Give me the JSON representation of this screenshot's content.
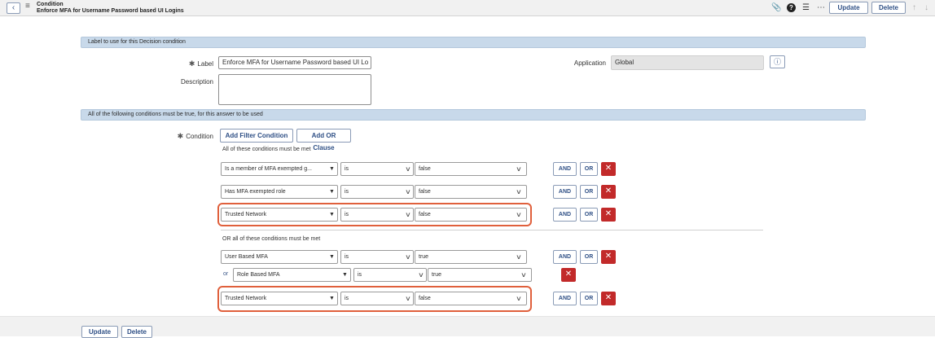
{
  "header": {
    "back_icon": "chevron-left-icon",
    "menu_icon": "hamburger-icon",
    "title": "Condition",
    "subtitle": "Enforce MFA for Username Password based UI Logins",
    "icons": [
      "paperclip-icon",
      "help-icon",
      "settings-icon",
      "more-icon"
    ],
    "update_label": "Update",
    "delete_label": "Delete",
    "up_icon": "arrow-up-icon",
    "down_icon": "arrow-down-icon"
  },
  "section1": {
    "title": "Label to use for this Decision condition",
    "label_label": "Label",
    "label_value": "Enforce MFA for Username Password based UI Lo",
    "description_label": "Description",
    "description_value": "",
    "application_label": "Application",
    "application_value": "Global"
  },
  "section2": {
    "title": "All of the following conditions must be true, for this answer to be used",
    "condition_label": "Condition",
    "add_filter_label": "Add Filter Condition",
    "add_or_label": "Add OR Clause",
    "group1_heading": "All of these conditions must be met",
    "group1_rows": [
      {
        "field": "Is a member of MFA exempted g...",
        "op": "is",
        "value": "false"
      },
      {
        "field": "Has MFA exempted role",
        "op": "is",
        "value": "false"
      },
      {
        "field": "Trusted Network",
        "op": "is",
        "value": "false"
      }
    ],
    "group2_heading": "OR all of these conditions must be met",
    "group2_rows": [
      {
        "field": "User Based MFA",
        "op": "is",
        "value": "true"
      },
      {
        "prefix": "or",
        "field": "Role Based MFA",
        "op": "is",
        "value": "true"
      },
      {
        "field": "Trusted Network",
        "op": "is",
        "value": "false"
      }
    ],
    "and_label": "AND",
    "or_label": "OR",
    "delete_icon": "close-icon"
  },
  "footer": {
    "update_label": "Update",
    "delete_label": "Delete"
  },
  "colors": {
    "section_bar": "#c8d9ea",
    "delete_red": "#c22a2a",
    "highlight": "#e0603c",
    "button_text": "#2e4f85"
  }
}
